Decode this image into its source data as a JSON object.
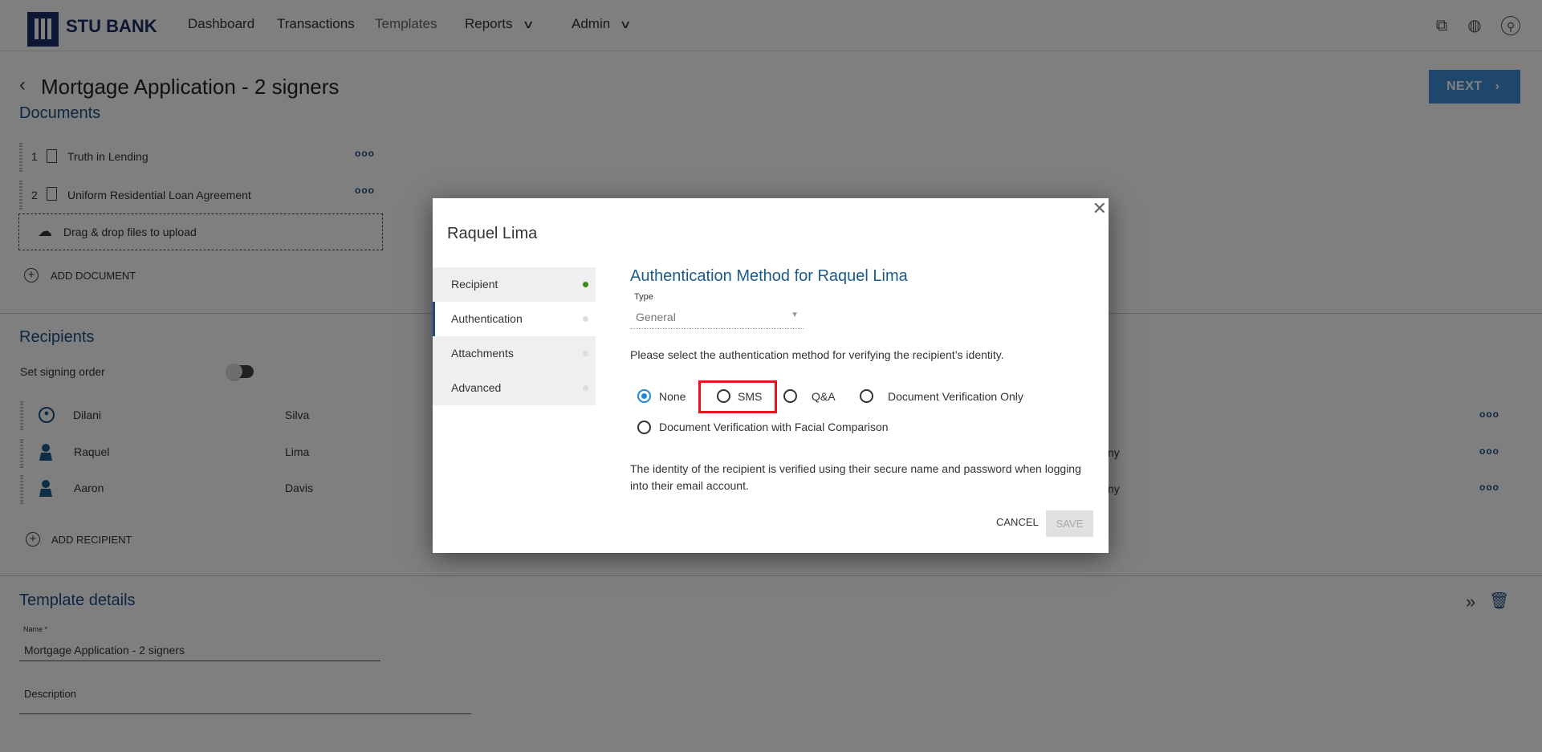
{
  "nav": {
    "brand": "STU BANK",
    "items": [
      "Dashboard",
      "Transactions",
      "Templates",
      "Reports",
      "Admin"
    ],
    "right_icons": [
      "org-chart-icon",
      "globe-icon",
      "user-icon"
    ]
  },
  "page": {
    "title": "Mortgage Application - 2 signers",
    "next_label": "NEXT"
  },
  "documents": {
    "heading": "Documents",
    "items": [
      {
        "num": "1",
        "name": "Truth in Lending"
      },
      {
        "num": "2",
        "name": "Uniform Residential Loan Agreement"
      }
    ],
    "dropzone": "Drag & drop files to upload",
    "add_label": "ADD DOCUMENT"
  },
  "recipients": {
    "heading": "Recipients",
    "signing_order_label": "Set signing order",
    "signing_order_on": false,
    "items": [
      {
        "first": "Dilani",
        "last": "Silva",
        "extra": ""
      },
      {
        "first": "Raquel",
        "last": "Lima",
        "extra": "ny"
      },
      {
        "first": "Aaron",
        "last": "Davis",
        "extra": "ny"
      }
    ],
    "add_label": "ADD RECIPIENT"
  },
  "template": {
    "heading": "Template details",
    "name_label": "Name *",
    "name_value": "Mortgage Application - 2 signers",
    "description_label": "Description"
  },
  "dialog": {
    "title": "Raquel Lima",
    "tabs": [
      {
        "label": "Recipient",
        "complete": true
      },
      {
        "label": "Authentication",
        "complete": false
      },
      {
        "label": "Attachments",
        "complete": false
      },
      {
        "label": "Advanced",
        "complete": false
      }
    ],
    "active_tab": "Authentication",
    "heading": "Authentication Method for Raquel Lima",
    "type_label": "Type",
    "type_value": "General",
    "instruction": "Please select the authentication method for verifying the recipient’s identity.",
    "options": [
      "None",
      "SMS",
      "Q&A",
      "Document Verification Only",
      "Document Verification with Facial Comparison"
    ],
    "selected": "None",
    "highlighted": "SMS",
    "description": "The identity of the recipient is verified using their secure name and password when logging into their email account.",
    "cancel_label": "CANCEL",
    "save_label": "SAVE"
  },
  "colors": {
    "accent": "#1c4f80",
    "radio": "#1e88d8",
    "highlight": "#e8141c",
    "complete": "#3a8a1a"
  }
}
